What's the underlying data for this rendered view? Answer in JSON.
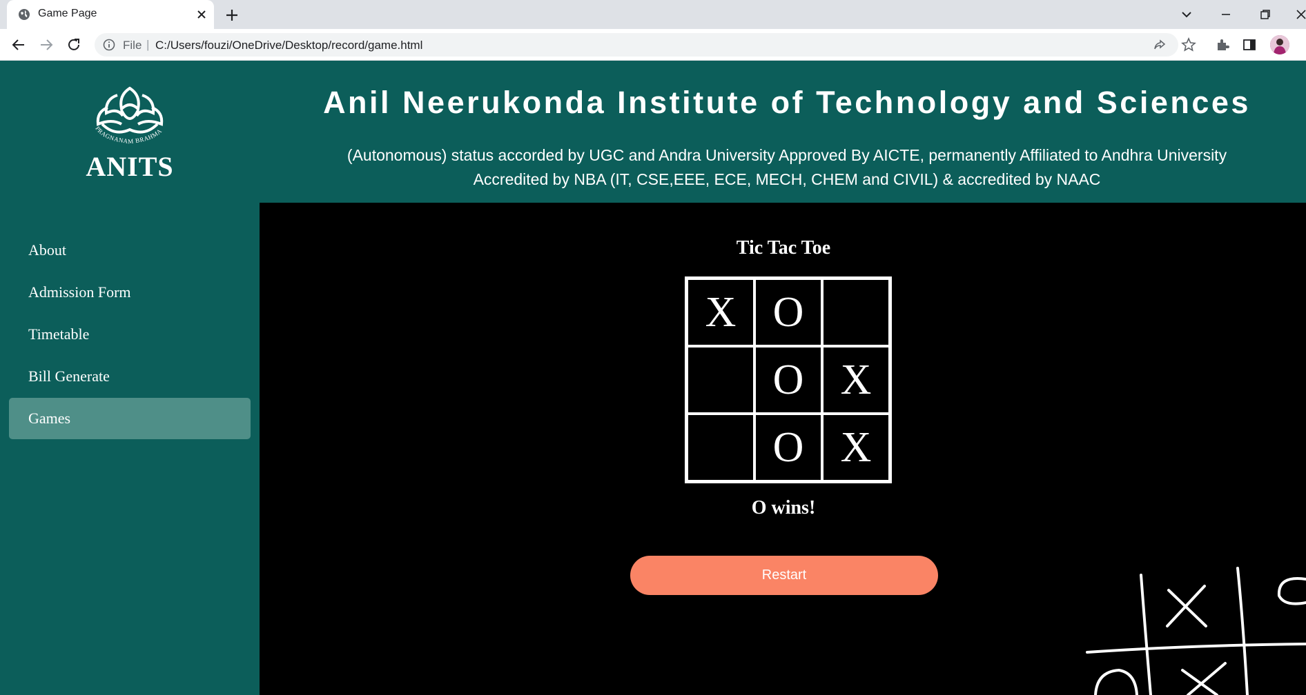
{
  "browser": {
    "tab_title": "Game Page",
    "url_scheme": "File",
    "url_path": "C:/Users/fouzi/OneDrive/Desktop/record/game.html"
  },
  "header": {
    "logo_text": "ANITS",
    "logo_motto": "PRAGNANAM BRAHMA",
    "title": "Anil Neerukonda Institute of Technology and Sciences",
    "subtitle_line1": "(Autonomous) status accorded by UGC and Andra University Approved By AICTE, permanently Affiliated to Andhra University",
    "subtitle_line2": "Accredited by NBA (IT, CSE,EEE, ECE, MECH, CHEM and CIVIL) & accredited by NAAC"
  },
  "sidebar": {
    "items": [
      {
        "label": "About"
      },
      {
        "label": "Admission Form"
      },
      {
        "label": "Timetable"
      },
      {
        "label": "Bill Generate"
      },
      {
        "label": "Games"
      }
    ],
    "active": "Games"
  },
  "game": {
    "title": "Tic Tac Toe",
    "board": [
      [
        "X",
        "O",
        ""
      ],
      [
        "",
        "O",
        "X"
      ],
      [
        "",
        "O",
        "X"
      ]
    ],
    "status": "O wins!",
    "restart_label": "Restart"
  },
  "colors": {
    "header_bg": "#0c5e5a",
    "sidebar_active": "#4f8f88",
    "restart_button": "#fa8465",
    "game_bg": "#000000"
  }
}
